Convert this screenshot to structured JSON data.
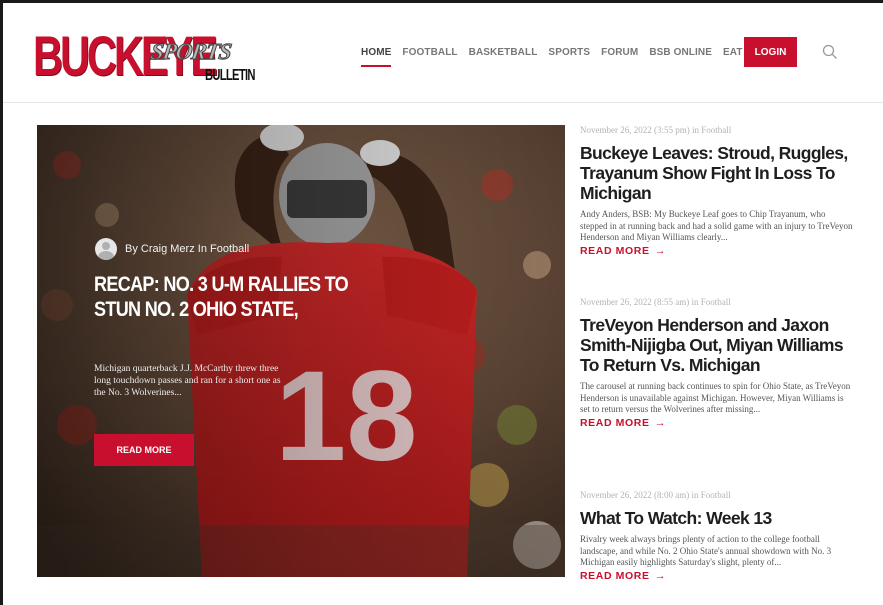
{
  "brand": {
    "logo_main": "BUCKEYE",
    "logo_sports": "SPORTS",
    "logo_bulletin": "BULLETIN",
    "accent_color": "#c8102e"
  },
  "nav": {
    "items": [
      {
        "label": "HOME",
        "active": true
      },
      {
        "label": "FOOTBALL",
        "active": false
      },
      {
        "label": "BASKETBALL",
        "active": false
      },
      {
        "label": "SPORTS",
        "active": false
      },
      {
        "label": "FORUM",
        "active": false
      },
      {
        "label": "BSB ONLINE",
        "active": false
      },
      {
        "label": "EAT & STAY",
        "active": false
      }
    ],
    "login_label": "LOGIN",
    "search_icon": "search-icon"
  },
  "hero": {
    "author_prefix": "By",
    "author": "Craig Merz",
    "category_prefix": "In",
    "category": "Football",
    "title": "RECAP: NO. 3 U-M RALLIES TO STUN NO. 2 OHIO STATE,",
    "excerpt": "Michigan quarterback J.J. McCarthy threw three long touchdown passes and ran for a short one as the No. 3 Wolverines...",
    "read_more": "READ MORE",
    "jersey_number": "18"
  },
  "articles": [
    {
      "meta": "November 26, 2022 (3:55 pm) in Football",
      "title": "Buckeye Leaves: Stroud, Ruggles, Trayanum Show Fight In Loss To Michigan",
      "excerpt": "Andy Anders, BSB: My Buckeye Leaf goes to Chip Trayanum, who stepped in at running back and had a solid game with an injury to TreVeyon Henderson and Miyan Williams clearly...",
      "read_more": "READ MORE"
    },
    {
      "meta": "November 26, 2022 (8:55 am) in Football",
      "title": "TreVeyon Henderson and Jaxon Smith-Nijigba Out, Miyan Williams To Return Vs. Michigan",
      "excerpt": "The carousel at running back continues to spin for Ohio State, as TreVeyon Henderson is unavailable against Michigan. However, Miyan Williams is set to return versus the Wolverines after missing...",
      "read_more": "READ MORE"
    },
    {
      "meta": "November 26, 2022 (8:00 am) in Football",
      "title": "What To Watch: Week 13",
      "excerpt": "Rivalry week always brings plenty of action to the college football landscape, and while No. 2 Ohio State's annual showdown with No. 3 Michigan easily highlights Saturday's slight, plenty of...",
      "read_more": "READ MORE"
    }
  ]
}
